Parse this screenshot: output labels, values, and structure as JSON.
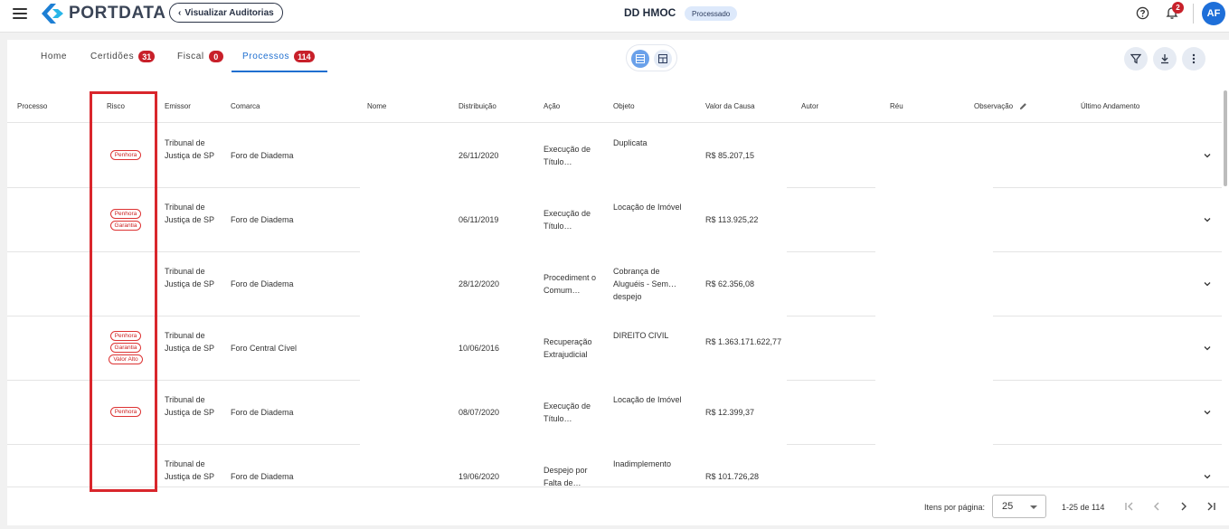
{
  "header": {
    "logo_text": "PORTDATA",
    "audit_button": "Visualizar Auditorias",
    "title": "DD HMOC",
    "status": "Processado",
    "notification_count": "2",
    "avatar_initials": "AF"
  },
  "tabs": [
    {
      "label": "Home",
      "count": ""
    },
    {
      "label": "Certidões",
      "count": "31"
    },
    {
      "label": "Fiscal",
      "count": "0"
    },
    {
      "label": "Processos",
      "count": "114"
    }
  ],
  "columns": [
    "Processo",
    "Risco",
    "Emissor",
    "Comarca",
    "Nome",
    "Distribuição",
    "Ação",
    "Objeto",
    "Valor da Causa",
    "Autor",
    "Réu",
    "Observação",
    "Último Andamento"
  ],
  "rows": [
    {
      "risco": [
        "Penhora"
      ],
      "emissor": "Tribunal de Justiça de SP",
      "comarca": "Foro de Diadema",
      "distribuicao": "26/11/2020",
      "acao": "Execução de Título…",
      "objeto": "Duplicata",
      "valor": "R$ 85.207,15"
    },
    {
      "risco": [
        "Penhora",
        "Garantia"
      ],
      "emissor": "Tribunal de Justiça de SP",
      "comarca": "Foro de Diadema",
      "distribuicao": "06/11/2019",
      "acao": "Execução de Título…",
      "objeto": "Locação de Imóvel",
      "valor": "R$ 113.925,22"
    },
    {
      "risco": [],
      "emissor": "Tribunal de Justiça de SP",
      "comarca": "Foro de Diadema",
      "distribuicao": "28/12/2020",
      "acao": "Procediment o Comum…",
      "objeto": "Cobrança de Aluguéis - Sem… despejo",
      "valor": "R$ 62.356,08"
    },
    {
      "risco": [
        "Penhora",
        "Garantia",
        "Valor Alto"
      ],
      "emissor": "Tribunal de Justiça de SP",
      "comarca": "Foro Central Cível",
      "distribuicao": "10/06/2016",
      "acao": "Recuperação Extrajudicial",
      "objeto": "DIREITO CIVIL",
      "valor": "R$ 1.363.171.622,77"
    },
    {
      "risco": [
        "Penhora"
      ],
      "emissor": "Tribunal de Justiça de SP",
      "comarca": "Foro de Diadema",
      "distribuicao": "08/07/2020",
      "acao": "Execução de Título…",
      "objeto": "Locação de Imóvel",
      "valor": "R$ 12.399,37"
    },
    {
      "risco": [],
      "emissor": "Tribunal de Justiça de SP",
      "comarca": "Foro de Diadema",
      "distribuicao": "19/06/2020",
      "acao": "Despejo por Falta de…",
      "objeto": "Inadimplemento",
      "valor": "R$ 101.726,28"
    }
  ],
  "pagination": {
    "items_per_page_label": "Itens por página:",
    "items_per_page": "25",
    "range": "1-25 de 114"
  },
  "icons": {
    "menu": "menu-icon",
    "help": "help-circle-icon",
    "notifications": "bell-icon",
    "filter": "filter-icon",
    "download": "download-icon",
    "more": "more-vertical-icon",
    "edit": "pencil-icon",
    "expand": "chevron-down-icon"
  },
  "colors": {
    "accent": "#1f6fd0",
    "danger": "#c8202a",
    "avatar": "#1e6fd9"
  }
}
